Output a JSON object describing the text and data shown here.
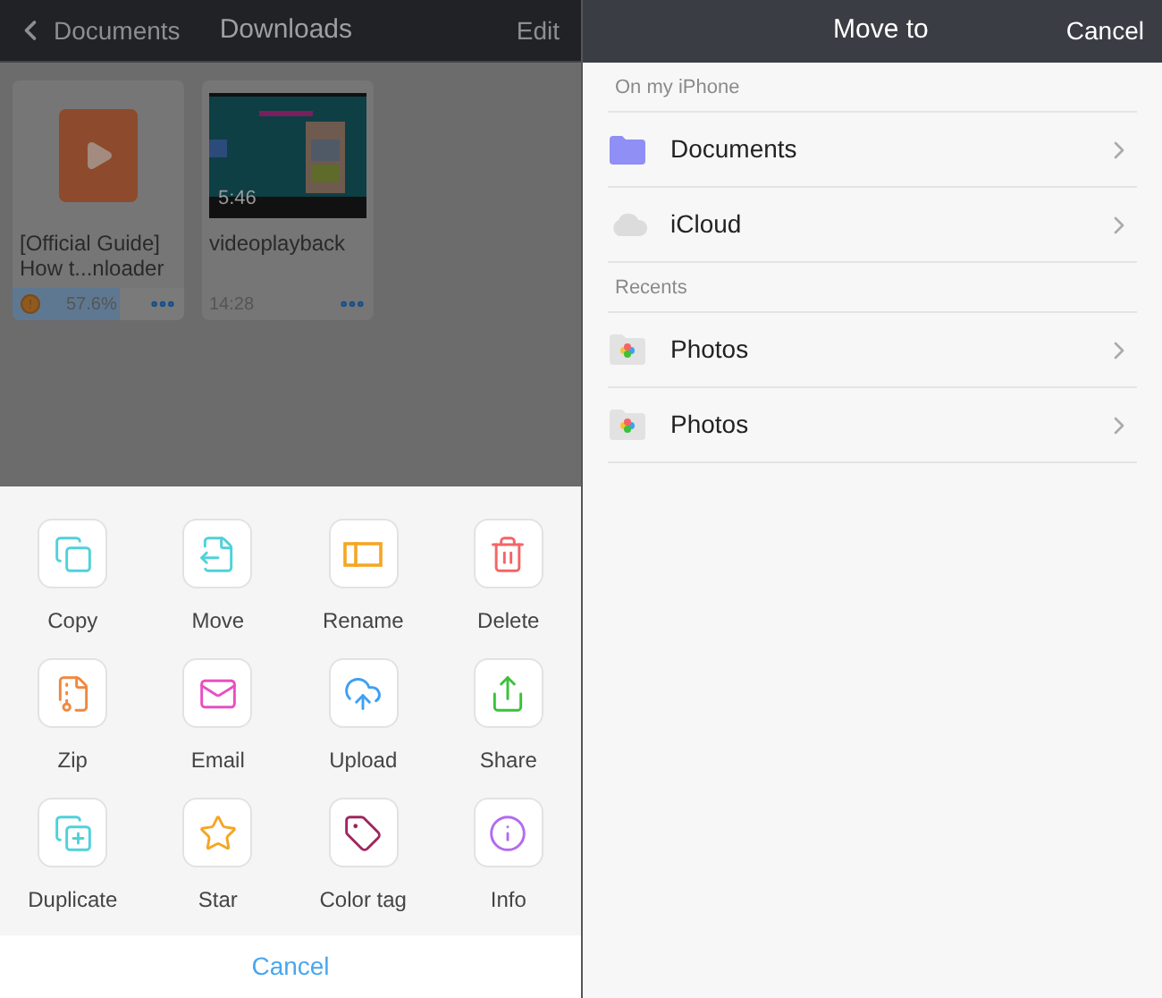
{
  "left": {
    "back": "Documents",
    "title": "Downloads",
    "edit": "Edit",
    "files": [
      {
        "kind": "download",
        "name": "[Official Guide] How t...nloader",
        "status": "57.6%",
        "level": 0.62
      },
      {
        "kind": "video",
        "name": "videoplayback",
        "duration": "5:46",
        "status": "14:28"
      }
    ],
    "actions": [
      {
        "kind": "copy",
        "label": "Copy"
      },
      {
        "kind": "move",
        "label": "Move"
      },
      {
        "kind": "rename",
        "label": "Rename"
      },
      {
        "kind": "delete",
        "label": "Delete"
      },
      {
        "kind": "zip",
        "label": "Zip"
      },
      {
        "kind": "email",
        "label": "Email"
      },
      {
        "kind": "upload",
        "label": "Upload"
      },
      {
        "kind": "share",
        "label": "Share"
      },
      {
        "kind": "duplicate",
        "label": "Duplicate"
      },
      {
        "kind": "star",
        "label": "Star"
      },
      {
        "kind": "tag",
        "label": "Color tag"
      },
      {
        "kind": "info",
        "label": "Info"
      }
    ],
    "cancel": "Cancel"
  },
  "right": {
    "title": "Move to",
    "cancel": "Cancel",
    "sections": [
      {
        "header": "On my iPhone",
        "items": [
          {
            "kind": "folder",
            "label": "Documents"
          },
          {
            "kind": "cloud",
            "label": "iCloud"
          }
        ]
      },
      {
        "header": "Recents",
        "items": [
          {
            "kind": "photos",
            "label": "Photos"
          },
          {
            "kind": "photos",
            "label": "Photos"
          }
        ]
      }
    ]
  }
}
